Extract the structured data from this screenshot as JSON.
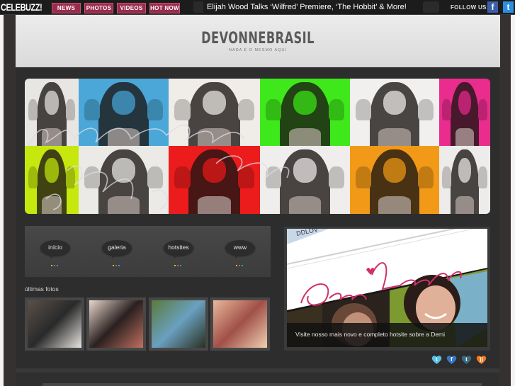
{
  "topbar": {
    "logo": "CELEBUZZ!",
    "nav": [
      "NEWS",
      "PHOTOS",
      "VIDEOS",
      "HOT NOW"
    ],
    "ticker_headline": "Elijah Wood Talks ‘Wilfred’ Premiere, ‘The Hobbit’ & More!",
    "follow_label": "FOLLOW US:",
    "social": [
      {
        "name": "facebook",
        "glyph": "f",
        "color": "#3b5ea8"
      },
      {
        "name": "twitter",
        "glyph": "t",
        "color": "#2b8fe0"
      }
    ],
    "nav_color": "#9b2b4d"
  },
  "header": {
    "title": "DEVONNEBRASIL",
    "subtitle": "NADA É O MESMO AQUI"
  },
  "banner": {
    "alt": "Demi Lovato pop-art collage",
    "tile_colors": [
      [
        "#e8e6e2",
        "#4aa7d8",
        "#f0ece8",
        "#3fe81a",
        "#f2f0ee",
        "#ea2c8e"
      ],
      [
        "#c6e80e",
        "#eceae6",
        "#ec1c1c",
        "#f0eeec",
        "#f29a18",
        "#eeecea"
      ]
    ]
  },
  "nav_menu": {
    "items": [
      "início",
      "galeria",
      "hotsites",
      "www"
    ],
    "dot_colors": [
      "#c8c824",
      "#d0507a",
      "#2aa0d8"
    ]
  },
  "latest_photos": {
    "label": "últimas fotos",
    "items": [
      {
        "alt": "photo 1",
        "tones": [
          "#5a5048",
          "#2a2a2a",
          "#e8e4e0"
        ]
      },
      {
        "alt": "photo 2",
        "tones": [
          "#e8d8cc",
          "#2a2020",
          "#c07060"
        ]
      },
      {
        "alt": "photo 3",
        "tones": [
          "#5a7a3a",
          "#6aa0c0",
          "#2a3020"
        ]
      },
      {
        "alt": "photo 4",
        "tones": [
          "#e8b89a",
          "#a05048",
          "#f0d0b0"
        ]
      }
    ]
  },
  "featured": {
    "signature": "Demi Lovato",
    "browser_text": "DDLOV",
    "caption": "Visite nosso mais novo e completo hotsite sobre a Demi"
  },
  "share_icons": [
    {
      "name": "twitter",
      "glyph": "t",
      "color": "#5cc0e8"
    },
    {
      "name": "facebook",
      "glyph": "f",
      "color": "#3a78c8"
    },
    {
      "name": "tumblr",
      "glyph": "t",
      "color": "#3a6a80"
    },
    {
      "name": "rss",
      "glyph": "))",
      "color": "#f07820"
    }
  ]
}
